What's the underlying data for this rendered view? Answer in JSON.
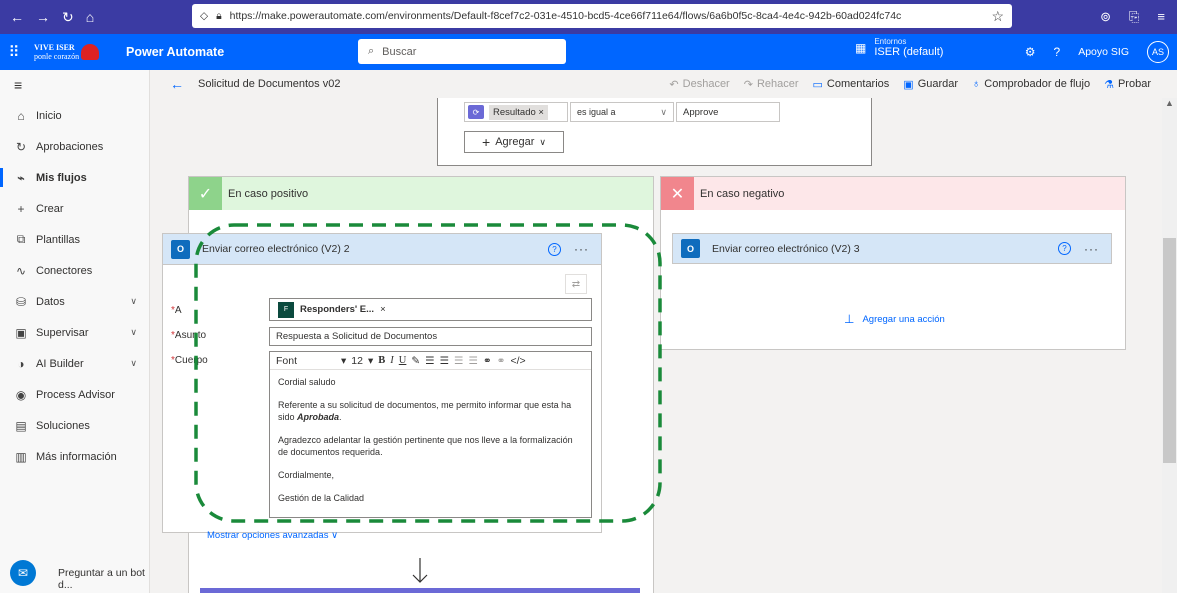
{
  "browser": {
    "url": "https://make.powerautomate.com/environments/Default-f8cef7c2-031e-4510-bcd5-4ce66f711e64/flows/6a6b0f5c-8ca4-4e4c-942b-60ad024fc74c",
    "nav_icons": [
      "back-arrow",
      "forward-arrow",
      "reload",
      "home"
    ],
    "right_icons": [
      "shield",
      "extensions",
      "menu"
    ]
  },
  "app": {
    "logo_text_1": "VIVE ISER",
    "logo_text_2": "ponle corazón",
    "title": "Power Automate",
    "search_placeholder": "Buscar",
    "env_label": "Entornos",
    "env_name": "ISER (default)",
    "help": "?",
    "user_name": "Apoyo SIG",
    "user_initials": "AS"
  },
  "sidebar": {
    "items": [
      {
        "label": "Inicio",
        "icon": "home-icon"
      },
      {
        "label": "Aprobaciones",
        "icon": "approvals-icon"
      },
      {
        "label": "Mis flujos",
        "icon": "flows-icon",
        "active": true
      },
      {
        "label": "Crear",
        "icon": "plus-icon"
      },
      {
        "label": "Plantillas",
        "icon": "templates-icon"
      },
      {
        "label": "Conectores",
        "icon": "connectors-icon"
      },
      {
        "label": "Datos",
        "icon": "data-icon",
        "expandable": true
      },
      {
        "label": "Supervisar",
        "icon": "monitor-icon",
        "expandable": true
      },
      {
        "label": "AI Builder",
        "icon": "ai-icon",
        "expandable": true
      },
      {
        "label": "Process Advisor",
        "icon": "process-icon"
      },
      {
        "label": "Soluciones",
        "icon": "solutions-icon"
      },
      {
        "label": "Más información",
        "icon": "learn-icon"
      }
    ],
    "bot_label": "Preguntar a un bot d..."
  },
  "cmdbar": {
    "flow_name": "Solicitud de Documentos v02",
    "undo": "Deshacer",
    "redo": "Rehacer",
    "comments": "Comentarios",
    "save": "Guardar",
    "checker": "Comprobador de flujo",
    "test": "Probar"
  },
  "condition": {
    "token": "Resultado",
    "operator": "es igual a",
    "value": "Approve",
    "add": "Agregar"
  },
  "yes_branch": {
    "title": "En caso positivo",
    "action_title": "Enviar correo electrónico (V2) 2",
    "to_label": "A",
    "to_token": "Responders' E...",
    "subject_label": "Asunto",
    "subject_value": "Respuesta a Solicitud de Documentos",
    "body_label": "Cuerpo",
    "font": "Font",
    "font_size": "12",
    "body": {
      "p1": "Cordial saludo",
      "p2a": "Referente a su solicitud de documentos, me permito informar que esta ha sido",
      "p2b": "Aprobada",
      "p3": "Agradezco adelantar la gestión pertinente que nos lleve a la formalización de documentos requerida.",
      "p4": "Cordialmente,",
      "p5": "Gestión de la Calidad"
    },
    "advanced": "Mostrar opciones avanzadas"
  },
  "no_branch": {
    "title": "En caso negativo",
    "action_title": "Enviar correo electrónico (V2) 3",
    "add_action": "Agregar una acción"
  },
  "colors": {
    "browser_bar": "#3b3ba3",
    "app_bar": "#0066ff",
    "yes_header": "#dff6dd",
    "no_header": "#fde7e9",
    "action_header": "#d5e6f7",
    "dash_highlight": "#1a8a3a"
  }
}
